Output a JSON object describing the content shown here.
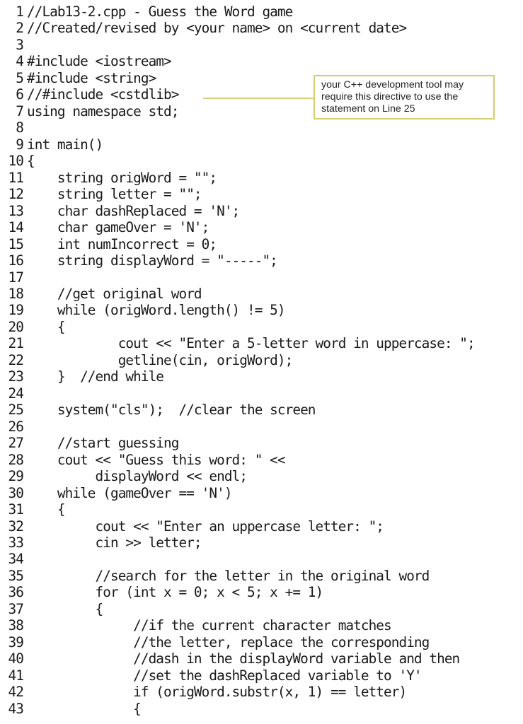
{
  "document": {
    "kind": "code-listing",
    "language": "C++",
    "lines": [
      {
        "n": "1",
        "text": "//Lab13-2.cpp - Guess the Word game"
      },
      {
        "n": "2",
        "text": "//Created/revised by <your name> on <current date>"
      },
      {
        "n": "3",
        "text": ""
      },
      {
        "n": "4",
        "text": "#include <iostream>"
      },
      {
        "n": "5",
        "text": "#include <string>"
      },
      {
        "n": "6",
        "text": "//#include <cstdlib>"
      },
      {
        "n": "7",
        "text": "using namespace std;"
      },
      {
        "n": "8",
        "text": ""
      },
      {
        "n": "9",
        "text": "int main()"
      },
      {
        "n": "10",
        "text": "{"
      },
      {
        "n": "11",
        "text": "    string origWord = \"\";"
      },
      {
        "n": "12",
        "text": "    string letter = \"\";"
      },
      {
        "n": "13",
        "text": "    char dashReplaced = 'N';"
      },
      {
        "n": "14",
        "text": "    char gameOver = 'N';"
      },
      {
        "n": "15",
        "text": "    int numIncorrect = 0;"
      },
      {
        "n": "16",
        "text": "    string displayWord = \"-----\";"
      },
      {
        "n": "17",
        "text": ""
      },
      {
        "n": "18",
        "text": "    //get original word"
      },
      {
        "n": "19",
        "text": "    while (origWord.length() != 5)"
      },
      {
        "n": "20",
        "text": "    {"
      },
      {
        "n": "21",
        "text": "            cout << \"Enter a 5-letter word in uppercase: \";"
      },
      {
        "n": "22",
        "text": "            getline(cin, origWord);"
      },
      {
        "n": "23",
        "text": "    }  //end while"
      },
      {
        "n": "24",
        "text": ""
      },
      {
        "n": "25",
        "text": "    system(\"cls\");  //clear the screen"
      },
      {
        "n": "26",
        "text": ""
      },
      {
        "n": "27",
        "text": "    //start guessing"
      },
      {
        "n": "28",
        "text": "    cout << \"Guess this word: \" <<"
      },
      {
        "n": "29",
        "text": "         displayWord << endl;"
      },
      {
        "n": "30",
        "text": "    while (gameOver == 'N')"
      },
      {
        "n": "31",
        "text": "    {"
      },
      {
        "n": "32",
        "text": "         cout << \"Enter an uppercase letter: \";"
      },
      {
        "n": "33",
        "text": "         cin >> letter;"
      },
      {
        "n": "34",
        "text": ""
      },
      {
        "n": "35",
        "text": "         //search for the letter in the original word"
      },
      {
        "n": "36",
        "text": "         for (int x = 0; x < 5; x += 1)"
      },
      {
        "n": "37",
        "text": "         {"
      },
      {
        "n": "38",
        "text": "              //if the current character matches"
      },
      {
        "n": "39",
        "text": "              //the letter, replace the corresponding"
      },
      {
        "n": "40",
        "text": "              //dash in the displayWord variable and then"
      },
      {
        "n": "41",
        "text": "              //set the dashReplaced variable to 'Y'"
      },
      {
        "n": "42",
        "text": "              if (origWord.substr(x, 1) == letter)"
      },
      {
        "n": "43",
        "text": "              {"
      }
    ]
  },
  "callout": {
    "target_line": "6",
    "lines": [
      "your C++ development tool may",
      "require this directive to use the",
      "statement on Line 25"
    ],
    "border_color": "#d4cd72"
  }
}
